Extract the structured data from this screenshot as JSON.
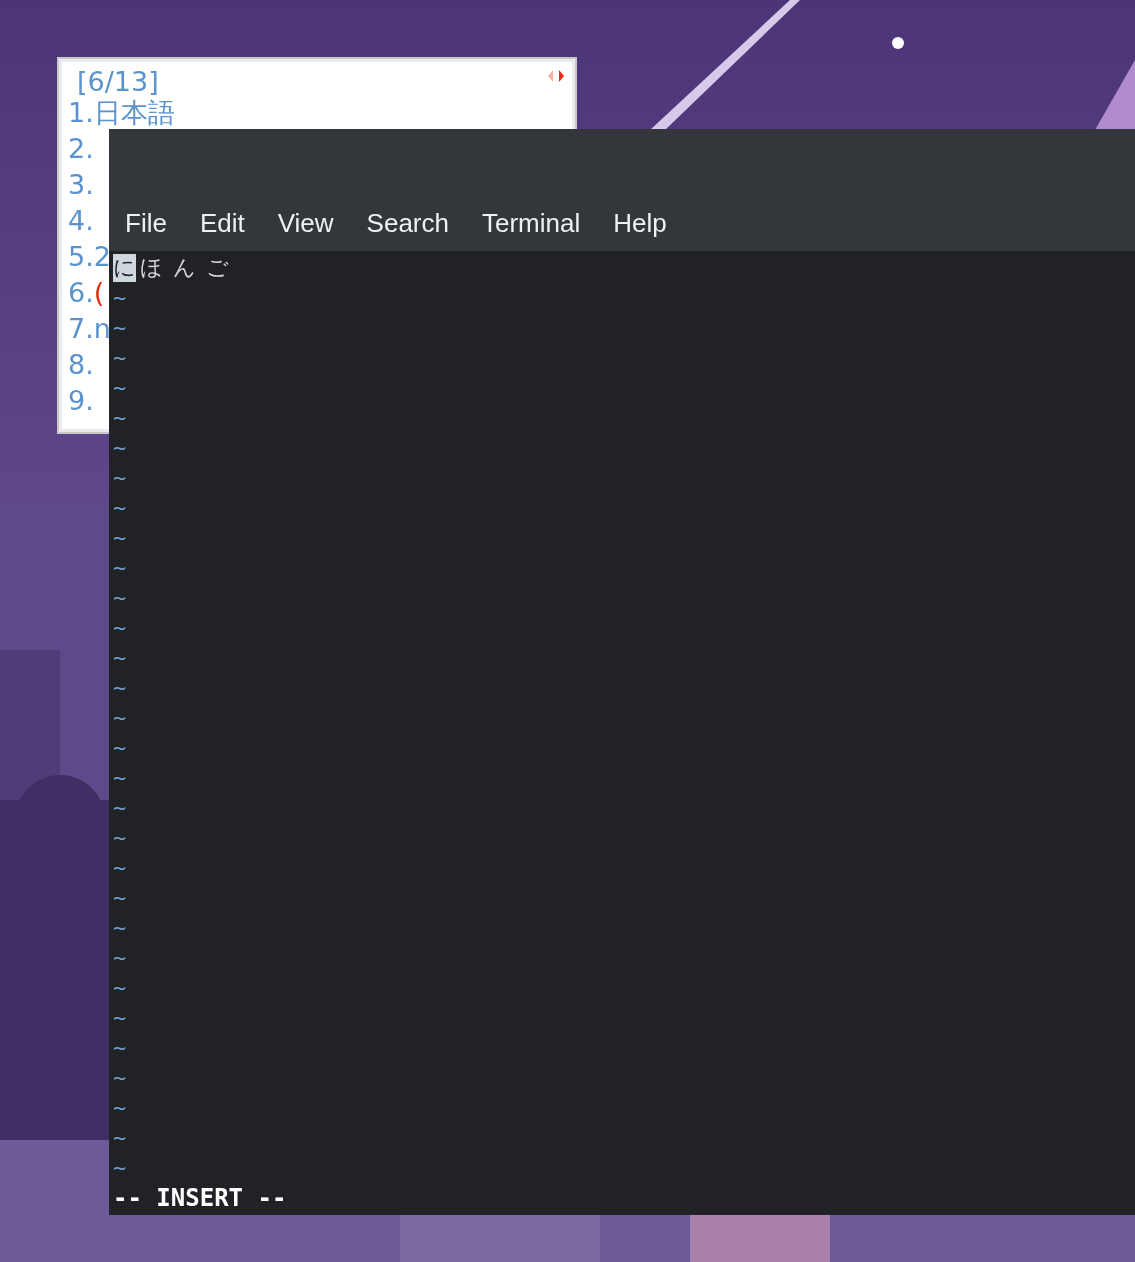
{
  "candidate_window": {
    "page": "[6/13]",
    "candidates": [
      {
        "number": "1.",
        "text": "日本語",
        "selected": false
      },
      {
        "number": "2.",
        "selected": false
      },
      {
        "number": "3.",
        "selected": false
      },
      {
        "number": "4.",
        "selected": false
      },
      {
        "number": "5.",
        "text": "2",
        "selected": false
      },
      {
        "number": "6.",
        "text": "(",
        "selected": true
      },
      {
        "number": "7.",
        "text": "n",
        "selected": false
      },
      {
        "number": "8.",
        "selected": false
      },
      {
        "number": "9.",
        "selected": false
      }
    ]
  },
  "terminal": {
    "menu": [
      "File",
      "Edit",
      "View",
      "Search",
      "Terminal",
      "Help"
    ],
    "buffer": {
      "cursor_char": "に",
      "rest": "ほんご"
    },
    "tilde_lines": [
      "~",
      "~",
      "~",
      "~",
      "~",
      "~",
      "~",
      "~",
      "~",
      "~",
      "~",
      "~",
      "~",
      "~",
      "~",
      "~",
      "~",
      "~",
      "~",
      "~",
      "~",
      "~",
      "~",
      "~",
      "~",
      "~",
      "~",
      "~",
      "~",
      "~"
    ],
    "mode": "-- INSERT --"
  }
}
